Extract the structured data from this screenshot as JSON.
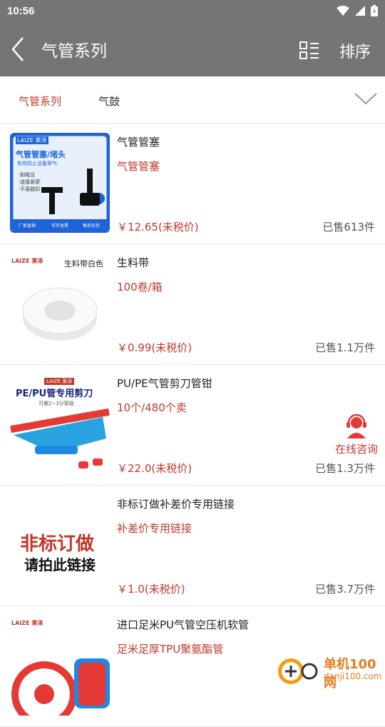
{
  "status": {
    "time": "10:56"
  },
  "header": {
    "title": "气管系列",
    "sort_label": "排序"
  },
  "filter": {
    "tabs": [
      {
        "label": "气管系列",
        "active": true
      },
      {
        "label": "气鼓",
        "active": false
      }
    ]
  },
  "products": [
    {
      "title": "气管管塞",
      "subtitle": "气管管塞",
      "price": "￥12.65(未税价)",
      "sold": "已售613件",
      "thumb": {
        "brand": "LAIZE 莱泽",
        "headline": "气管管塞/堵头",
        "tagline": "有效防止设备窜气",
        "features": [
          "·耐吸压",
          "·连接紧密",
          "·不易脱扣"
        ],
        "badges": [
          "厂家直销",
          "可开发票",
          "售后无忧"
        ]
      }
    },
    {
      "title": "生料带",
      "subtitle": "100卷/箱",
      "price": "￥0.99(未税价)",
      "sold": "已售1.1万件",
      "thumb": {
        "brand": "LAIZE 莱泽",
        "caption": "生料带白色"
      }
    },
    {
      "title": "PU/PE气管剪刀管钳",
      "subtitle": "10个/480个卖",
      "price": "￥22.0(未税价)",
      "sold": "已售1.3万件",
      "thumb": {
        "brand": "LAIZE 莱泽",
        "headline": "PE/PU管专用剪刀",
        "caption": "可裁2~3分管路"
      }
    },
    {
      "title": "非标订做补差价专用链接",
      "subtitle": "补差价专用链接",
      "price": "￥1.0(未税价)",
      "sold": "已售3.7万件",
      "thumb": {
        "line1": "非标订做",
        "line2": "请拍此链接"
      }
    },
    {
      "title": "进口足米PU气管空压机软管",
      "subtitle": "足米足厚TPU聚氨酯管",
      "price": "",
      "sold": "",
      "thumb": {
        "brand": "LAIZE 莱泽"
      }
    }
  ],
  "consult": {
    "label": "在线咨询"
  },
  "watermark": {
    "name": "单机100网",
    "url": "danji100.com"
  },
  "colors": {
    "appbar": "#757575",
    "accent": "#c0392b"
  }
}
